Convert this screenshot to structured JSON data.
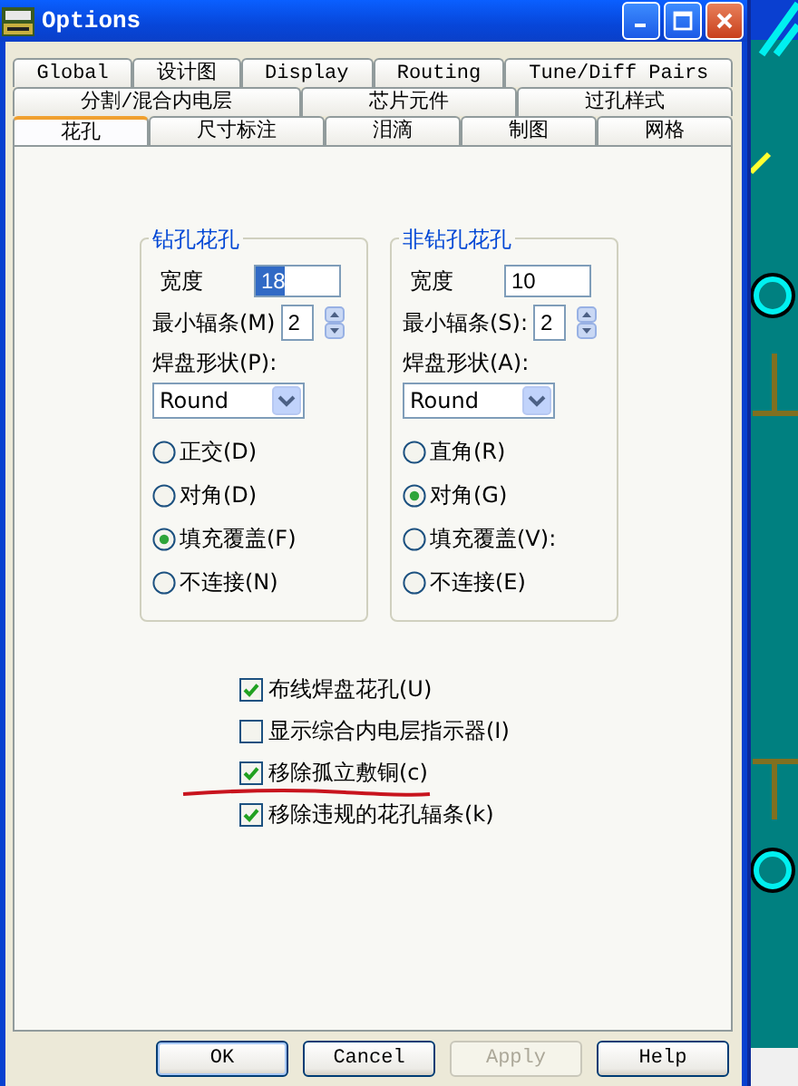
{
  "window": {
    "title": "Options"
  },
  "tab_rows": [
    {
      "tabs": [
        {
          "label": "Global",
          "selected": false
        },
        {
          "label": "设计图",
          "selected": false
        },
        {
          "label": "Display",
          "selected": false
        },
        {
          "label": "Routing",
          "selected": false
        },
        {
          "label": "Tune/Diff Pairs",
          "selected": false
        }
      ]
    },
    {
      "tabs": [
        {
          "label": "分割/混合内电层",
          "selected": false
        },
        {
          "label": "芯片元件",
          "selected": false
        },
        {
          "label": "过孔样式",
          "selected": false
        }
      ]
    },
    {
      "tabs": [
        {
          "label": "花孔",
          "selected": true
        },
        {
          "label": "尺寸标注",
          "selected": false
        },
        {
          "label": "泪滴",
          "selected": false
        },
        {
          "label": "制图",
          "selected": false
        },
        {
          "label": "网格",
          "selected": false
        }
      ]
    }
  ],
  "groups": [
    {
      "title": "钻孔花孔",
      "width_label": "宽度",
      "width_value": "18",
      "spokes_label": "最小辐条(M)",
      "spokes_value": "2",
      "shape_label": "焊盘形状(P):",
      "shape_value": "Round",
      "options": [
        {
          "label": "正交(D)",
          "selected": false
        },
        {
          "label": "对角(D)",
          "selected": false
        },
        {
          "label": "填充覆盖(F)",
          "selected": true
        },
        {
          "label": "不连接(N)",
          "selected": false
        }
      ]
    },
    {
      "title": "非钻孔花孔",
      "width_label": "宽度",
      "width_value": "10",
      "spokes_label": "最小辐条(S):",
      "spokes_value": "2",
      "shape_label": "焊盘形状(A):",
      "shape_value": "Round",
      "options": [
        {
          "label": "直角(R)",
          "selected": false
        },
        {
          "label": "对角(G)",
          "selected": true
        },
        {
          "label": "填充覆盖(V):",
          "selected": false
        },
        {
          "label": "不连接(E)",
          "selected": false
        }
      ]
    }
  ],
  "checkboxes": [
    {
      "label": "布线焊盘花孔(U)",
      "checked": true
    },
    {
      "label": "显示综合内电层指示器(I)",
      "checked": false
    },
    {
      "label": "移除孤立敷铜(c)",
      "checked": true
    },
    {
      "label": "移除违规的花孔辐条(k)",
      "checked": true
    }
  ],
  "buttons": [
    {
      "label": "OK",
      "disabled": false
    },
    {
      "label": "Cancel",
      "disabled": false
    },
    {
      "label": "Apply",
      "disabled": true
    },
    {
      "label": "Help",
      "disabled": false
    }
  ]
}
